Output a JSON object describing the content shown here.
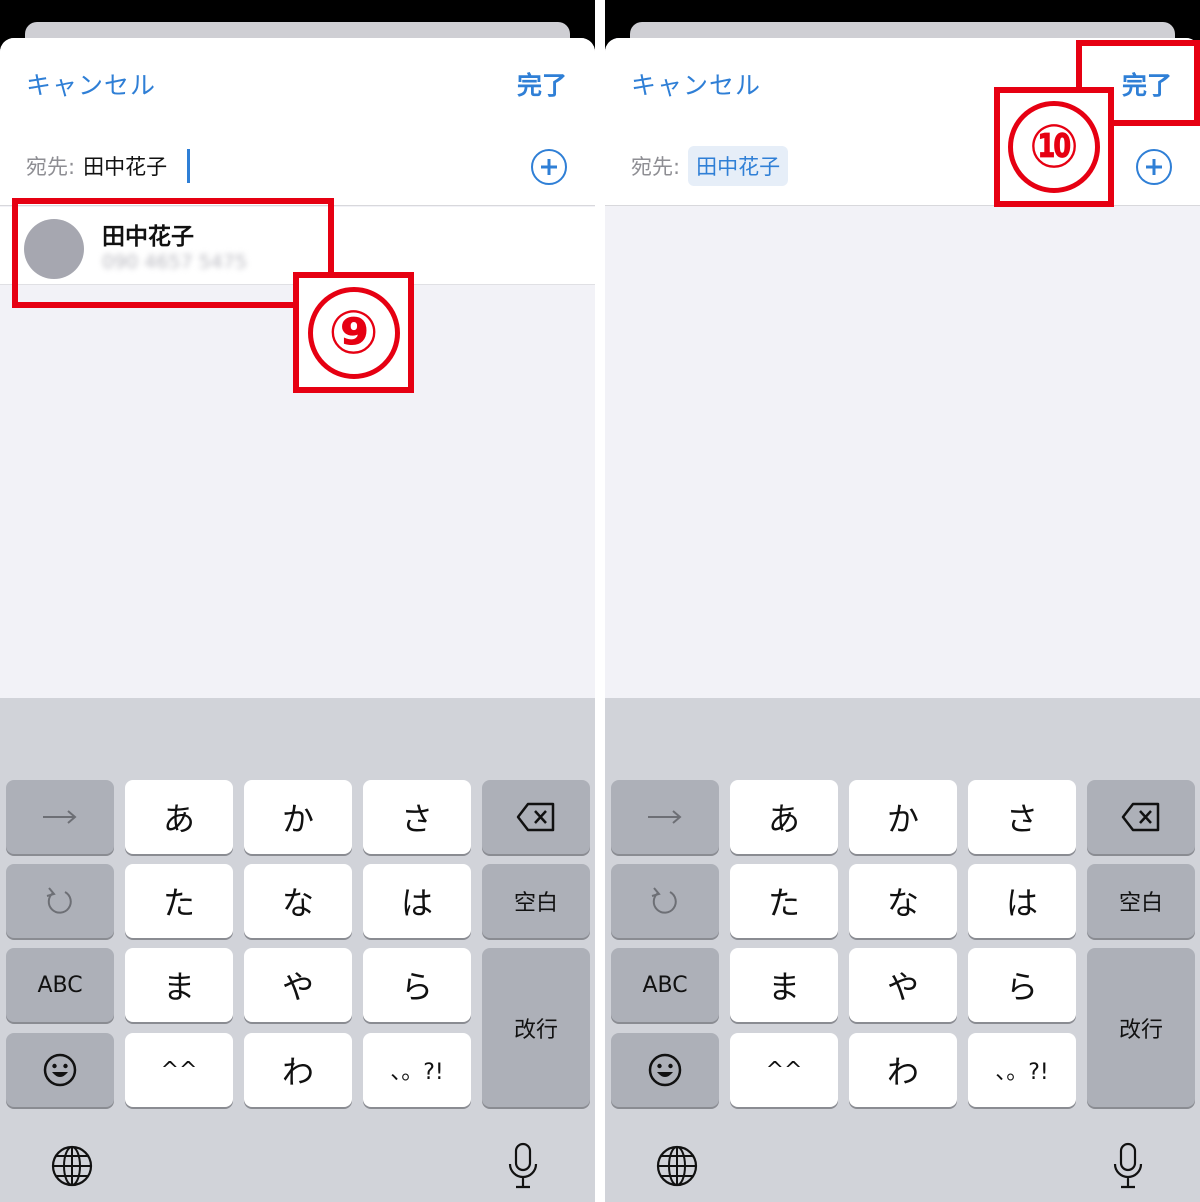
{
  "colors": {
    "accent": "#2f7fd6",
    "annotation": "#e60012",
    "avatar": "#a6a7b0"
  },
  "panels": [
    {
      "nav": {
        "cancel": "キャンセル",
        "done": "完了"
      },
      "to_label": "宛先:",
      "to_value": "田中花子",
      "suggestion": {
        "name": "田中花子",
        "phone": "090 4657 5475"
      },
      "annotation": {
        "step": "⑨"
      }
    },
    {
      "nav": {
        "cancel": "キャンセル",
        "done": "完了"
      },
      "to_label": "宛先:",
      "to_chip": "田中花子",
      "annotation": {
        "step": "⑩"
      }
    }
  ],
  "keyboard": {
    "rows": [
      [
        "→",
        "あ",
        "か",
        "さ",
        "delete-icon"
      ],
      [
        "undo-icon",
        "た",
        "な",
        "は",
        "空白"
      ],
      [
        "ABC",
        "ま",
        "や",
        "ら",
        "改行"
      ],
      [
        "emoji-icon",
        "^^",
        "わ",
        "、。?!"
      ]
    ],
    "globe": "globe-icon",
    "mic": "mic-icon"
  }
}
